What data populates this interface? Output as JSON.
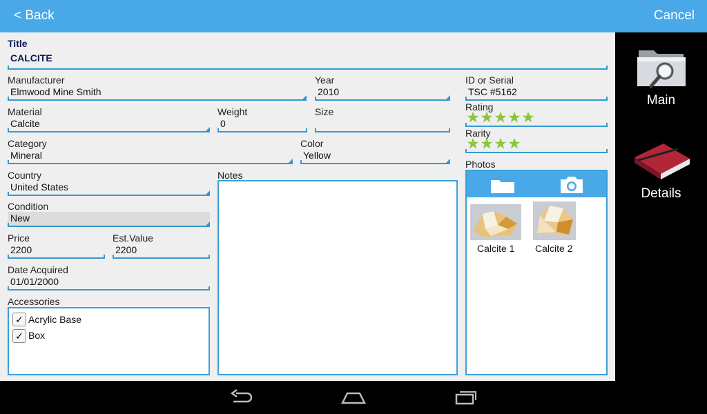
{
  "topbar": {
    "back_label": "< Back",
    "cancel_label": "Cancel"
  },
  "form": {
    "title": {
      "label": "Title",
      "value": "CALCITE"
    },
    "manufacturer": {
      "label": "Manufacturer",
      "value": "Elmwood Mine Smith"
    },
    "year": {
      "label": "Year",
      "value": "2010"
    },
    "id_serial": {
      "label": "ID or Serial",
      "value": "TSC #5162"
    },
    "material": {
      "label": "Material",
      "value": "Calcite"
    },
    "weight": {
      "label": "Weight",
      "value": "0"
    },
    "size": {
      "label": "Size",
      "value": ""
    },
    "rating": {
      "label": "Rating",
      "stars": 5
    },
    "rarity": {
      "label": "Rarity",
      "stars": 4
    },
    "category": {
      "label": "Category",
      "value": "Mineral"
    },
    "color": {
      "label": "Color",
      "value": "Yellow"
    },
    "country": {
      "label": "Country",
      "value": "United States"
    },
    "notes": {
      "label": "Notes",
      "value": ""
    },
    "photos": {
      "label": "Photos",
      "items": [
        {
          "caption": "Calcite 1"
        },
        {
          "caption": "Calcite 2"
        }
      ]
    },
    "condition": {
      "label": "Condition",
      "value": "New"
    },
    "price": {
      "label": "Price",
      "value": "2200"
    },
    "est_value": {
      "label": "Est.Value",
      "value": "2200"
    },
    "date_acquired": {
      "label": "Date Acquired",
      "value": "01/01/2000"
    },
    "accessories": {
      "label": "Accessories",
      "items": [
        {
          "label": "Acrylic Base",
          "checked": true,
          "mark": "✓"
        },
        {
          "label": "Box",
          "checked": true,
          "mark": "✓"
        }
      ]
    }
  },
  "right_panel": {
    "main_label": "Main",
    "details_label": "Details"
  },
  "colors": {
    "accent": "#48a8e8",
    "underline": "#3399cc",
    "star": "#8cc63f"
  }
}
